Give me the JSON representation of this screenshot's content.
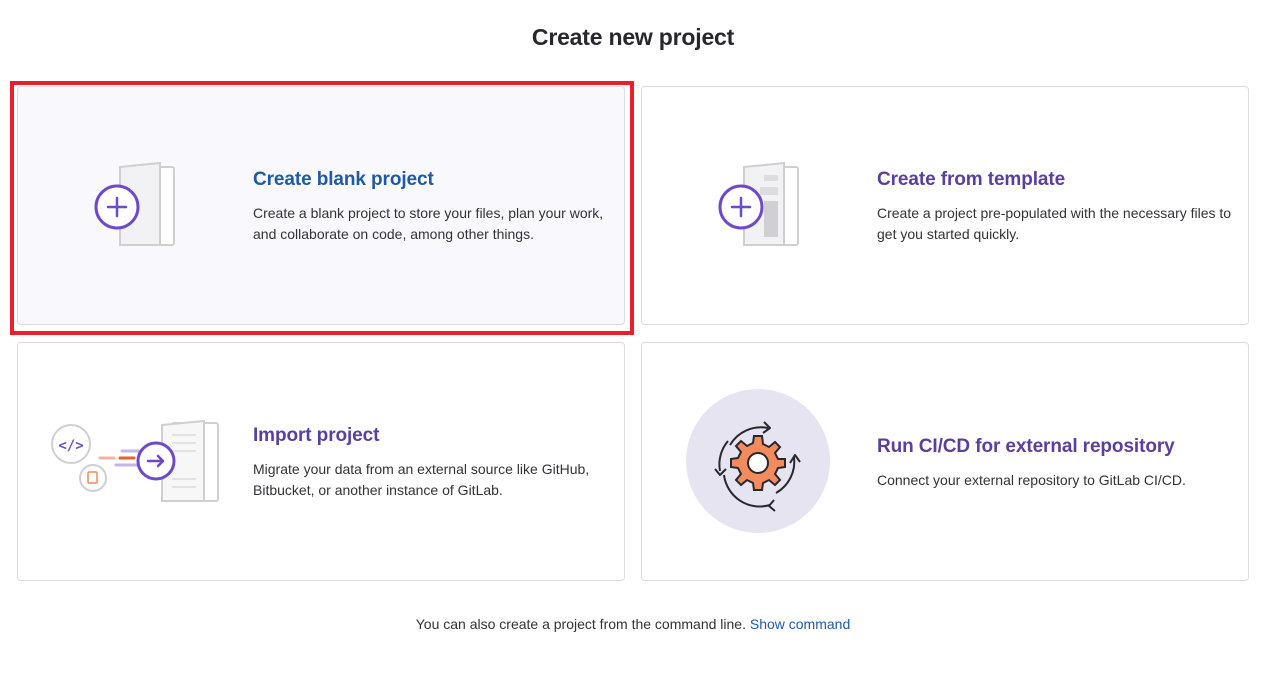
{
  "page": {
    "title": "Create new project"
  },
  "cards": [
    {
      "title": "Create blank project",
      "description": "Create a blank project to store your files, plan your work, and collaborate on code, among other things.",
      "icon": "blank-project-illustration",
      "selected": true
    },
    {
      "title": "Create from template",
      "description": "Create a project pre-populated with the necessary files to get you started quickly.",
      "icon": "template-project-illustration",
      "selected": false
    },
    {
      "title": "Import project",
      "description": "Migrate your data from an external source like GitHub, Bitbucket, or another instance of GitLab.",
      "icon": "import-project-illustration",
      "selected": false
    },
    {
      "title": "Run CI/CD for external repository",
      "description": "Connect your external repository to GitLab CI/CD.",
      "icon": "cicd-gear-illustration",
      "selected": false
    }
  ],
  "footer": {
    "text": "You can also create a project from the command line.",
    "link": "Show command"
  },
  "colors": {
    "accent_purple": "#6e49cb",
    "link_blue": "#1f5aa6",
    "highlight_red": "#e8202a",
    "cicd_orange": "#f38b5d",
    "cicd_circle": "#e7e4f2"
  }
}
